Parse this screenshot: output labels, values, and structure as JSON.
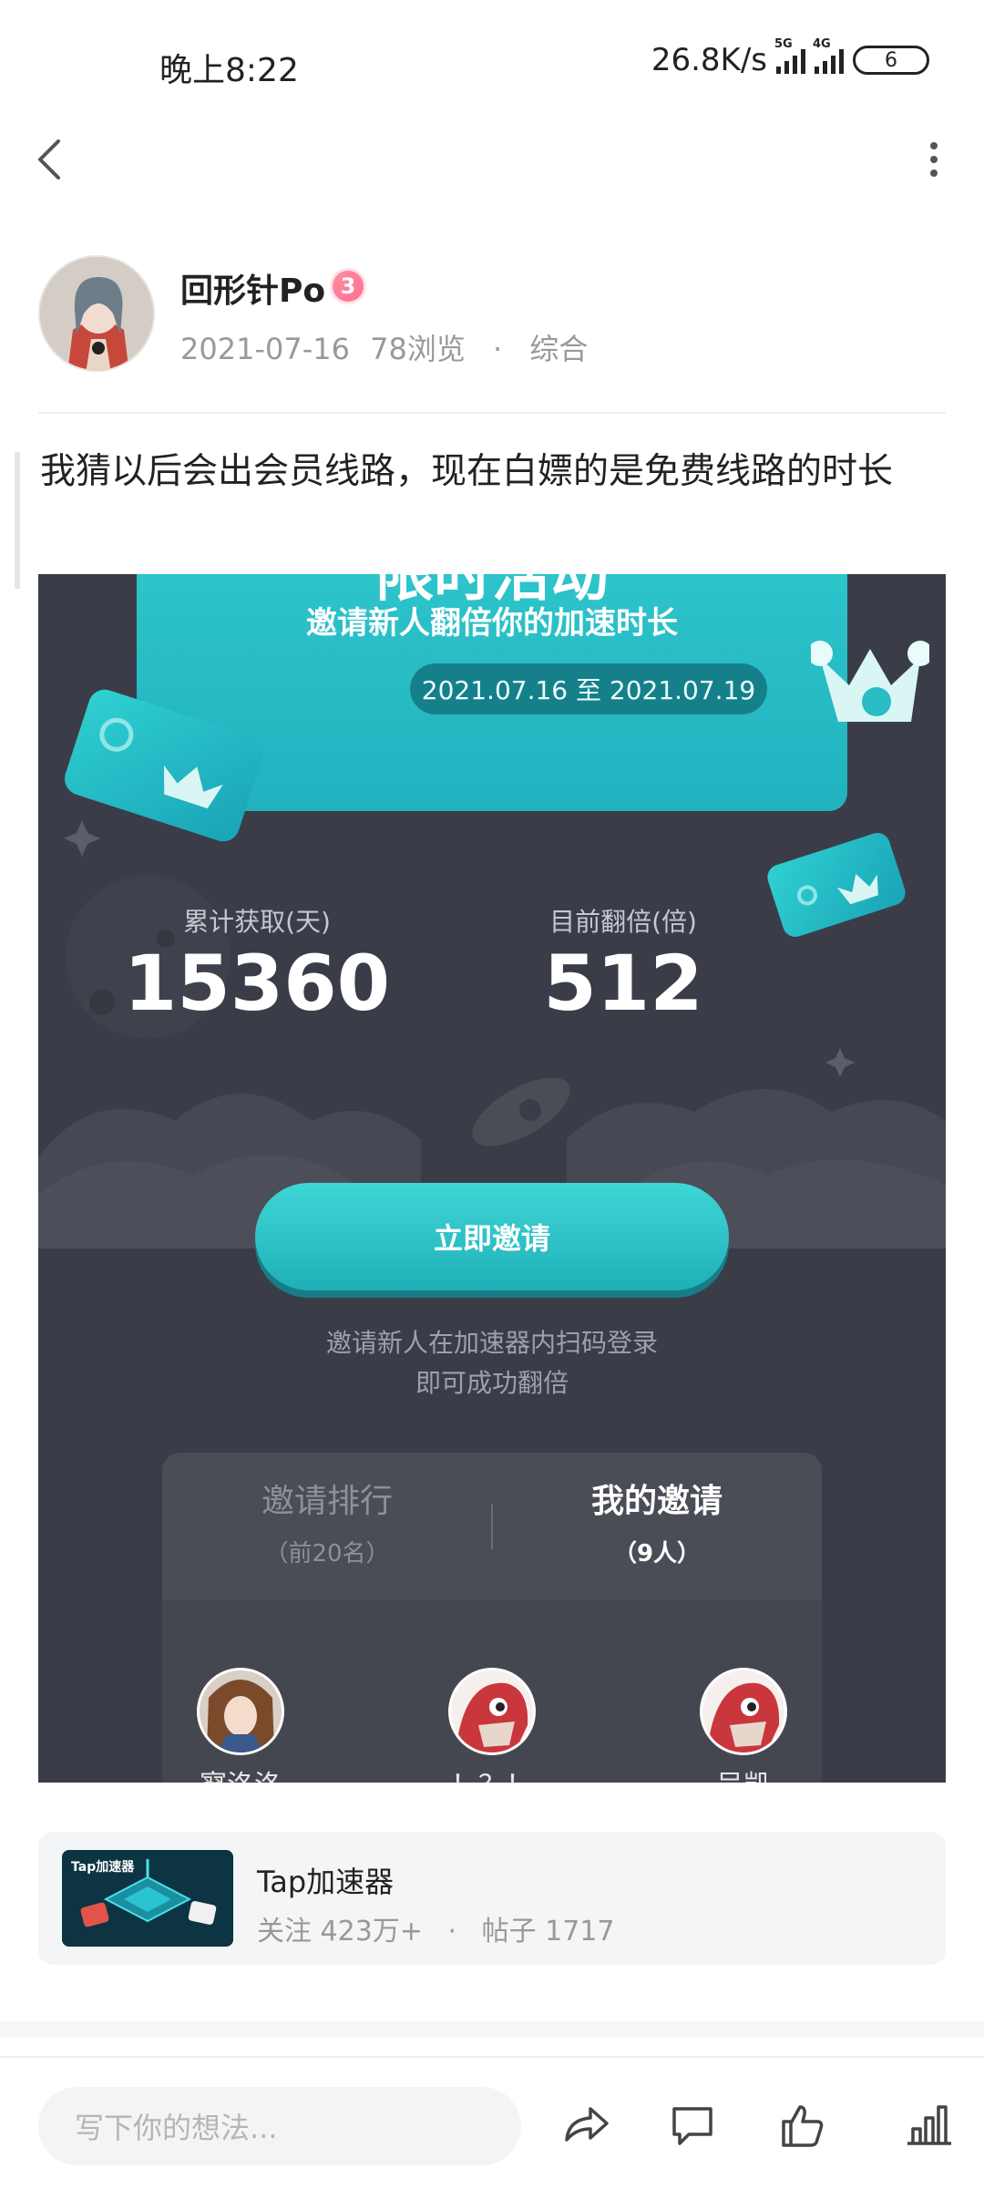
{
  "status_bar": {
    "time": "晚上8:22",
    "net_speed": "26.8K/s",
    "signal1_label": "5G",
    "signal2_label": "4G",
    "battery": "6"
  },
  "nav": {
    "back_icon": "chevron-left-icon",
    "more_icon": "more-vertical-icon"
  },
  "author": {
    "name": "回形针Po",
    "level": "3",
    "date": "2021-07-16",
    "views": "78浏览",
    "separator": "·",
    "category": "综合"
  },
  "post": {
    "text": "我猜以后会出会员线路，现在白嫖的是免费线路的时长"
  },
  "screenshot": {
    "banner_title": "限时活动",
    "banner_subtitle": "邀请新人翻倍你的加速时长",
    "date_range": "2021.07.16 至 2021.07.19",
    "stat1_label": "累计获取(天)",
    "stat1_value": "15360",
    "stat2_label": "目前翻倍(倍)",
    "stat2_value": "512",
    "invite_button": "立即邀请",
    "hint_line1": "邀请新人在加速器内扫码登录",
    "hint_line2": "即可成功翻倍",
    "tab_rank": "邀请排行",
    "tab_rank_sub": "（前20名）",
    "tab_mine": "我的邀请",
    "tab_mine_sub": "（9人）",
    "users": [
      "寥洛洛",
      "！？！",
      "吴凯"
    ]
  },
  "forum": {
    "name": "Tap加速器",
    "thumb_label": "Tap加速器",
    "follow": "关注 423万+",
    "separator": "·",
    "posts": "帖子 1717"
  },
  "bottom": {
    "comment_placeholder": "写下你的想法...",
    "icons": [
      "share-icon",
      "comment-icon",
      "like-icon",
      "stats-icon"
    ]
  },
  "colors": {
    "accent": "#21b1bf",
    "badge": "#ff6f91"
  }
}
